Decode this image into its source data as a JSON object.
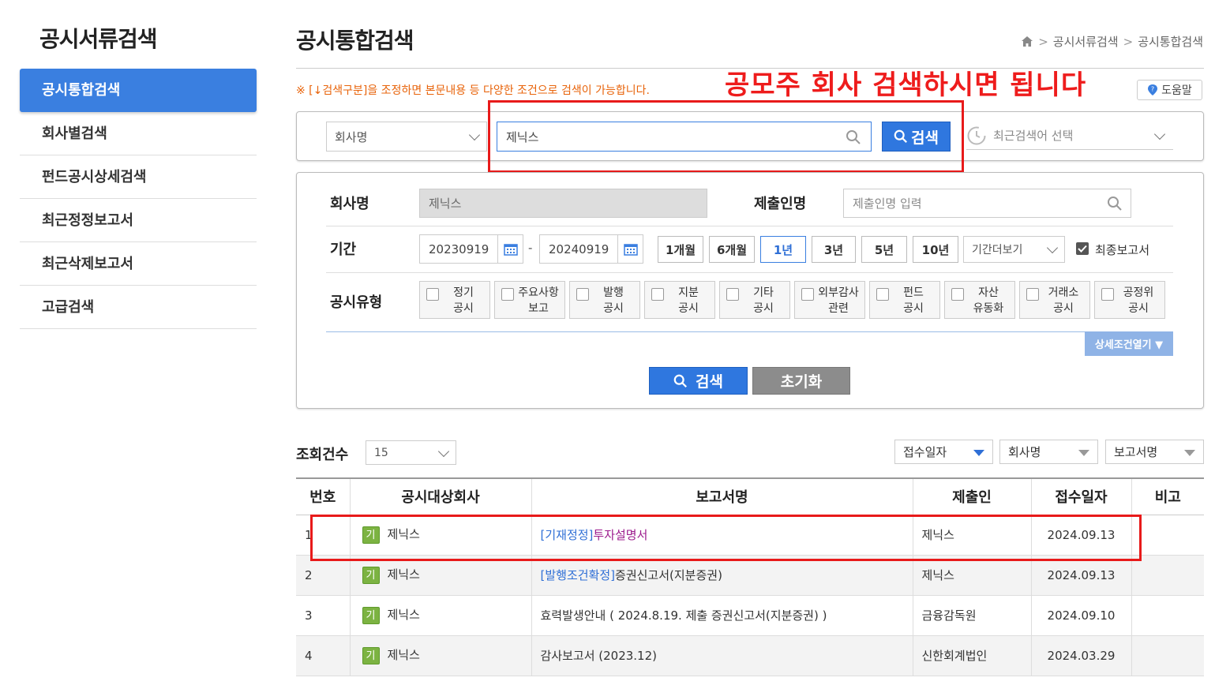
{
  "sidebar": {
    "title": "공시서류검색",
    "items": [
      {
        "label": "공시통합검색"
      },
      {
        "label": "회사별검색"
      },
      {
        "label": "펀드공시상세검색"
      },
      {
        "label": "최근정정보고서"
      },
      {
        "label": "최근삭제보고서"
      },
      {
        "label": "고급검색"
      }
    ]
  },
  "header": {
    "title": "공시통합검색",
    "breadcrumb": [
      "공시서류검색",
      "공시통합검색"
    ],
    "notice": "※ [↓검색구분]을 조정하면 본문내용 등 다양한 조건으로 검색이 가능합니다.",
    "overlay_note": "공모주 회사 검색하시면 됩니다",
    "help_label": "도움말"
  },
  "quick_search": {
    "type_select": "회사명",
    "query": "제닉스",
    "search_label": "검색",
    "recent_placeholder": "최근검색어 선택"
  },
  "form": {
    "company_label": "회사명",
    "company_value": "제닉스",
    "submitter_label": "제출인명",
    "submitter_placeholder": "제출인명 입력",
    "period_label": "기간",
    "date_from": "20230919",
    "date_to": "20240919",
    "date_sep": "-",
    "period_buttons": [
      "1개월",
      "6개월",
      "1년",
      "3년",
      "5년",
      "10년"
    ],
    "period_selected": "1년",
    "period_more": "기간더보기",
    "final_report_label": "최종보고서",
    "final_report_checked": true,
    "type_label": "공시유형",
    "types": [
      "정기\n공시",
      "주요사항\n보고",
      "발행\n공시",
      "지분\n공시",
      "기타\n공시",
      "외부감사\n관련",
      "펀드\n공시",
      "자산\n유동화",
      "거래소\n공시",
      "공정위\n공시"
    ],
    "detail_toggle": "상세조건열기 ▼",
    "search_label": "검색",
    "reset_label": "초기화"
  },
  "results": {
    "count_label": "조회건수",
    "count_value": "15",
    "sort_options": [
      "접수일자",
      "회사명",
      "보고서명"
    ],
    "columns": [
      "번호",
      "공시대상회사",
      "보고서명",
      "제출인",
      "접수일자",
      "비고"
    ],
    "badge": "기",
    "rows": [
      {
        "no": "1",
        "company": "제닉스",
        "report_prefix": "[기재정정]",
        "report_name": "투자설명서",
        "submitter": "제닉스",
        "date": "2024.09.13",
        "note": ""
      },
      {
        "no": "2",
        "company": "제닉스",
        "report_prefix": "[발행조건확정]",
        "report_name": "증권신고서(지분증권)",
        "submitter": "제닉스",
        "date": "2024.09.13",
        "note": ""
      },
      {
        "no": "3",
        "company": "제닉스",
        "report_prefix": "",
        "report_name": "효력발생안내 ( 2024.8.19. 제출 증권신고서(지분증권) )",
        "submitter": "금융감독원",
        "date": "2024.09.10",
        "note": ""
      },
      {
        "no": "4",
        "company": "제닉스",
        "report_prefix": "",
        "report_name": "감사보고서 (2023.12)",
        "submitter": "신한회계법인",
        "date": "2024.03.29",
        "note": ""
      }
    ]
  },
  "colors": {
    "accent": "#3a7fe0",
    "annotation_red": "#e81a1a",
    "notice_orange": "#e8630a",
    "badge_green": "#7cb342"
  }
}
